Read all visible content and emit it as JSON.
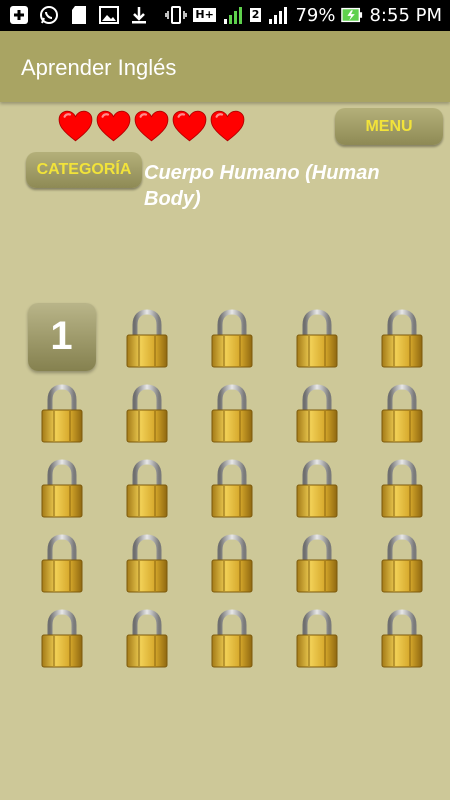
{
  "status_bar": {
    "left_icons": [
      "plus-icon",
      "whatsapp-icon",
      "sd-card-icon",
      "image-icon",
      "download-icon"
    ],
    "network_type": "H+",
    "sim2_label": "2",
    "battery_percent": "79%",
    "time": "8:55 PM"
  },
  "app_bar": {
    "title": "Aprender Inglés"
  },
  "hearts": {
    "count": 5,
    "color": "#ff0000"
  },
  "menu_button": {
    "label": "MENU"
  },
  "category": {
    "button_label": "CATEGORÍA",
    "name": "Cuerpo Humano (Human Body)"
  },
  "levels": {
    "unlocked": [
      {
        "number": "1"
      }
    ],
    "locked_count": 24,
    "columns": 5
  },
  "colors": {
    "background": "#cdc898",
    "app_bar": "#a9a463",
    "button_text": "#f2e33a"
  }
}
